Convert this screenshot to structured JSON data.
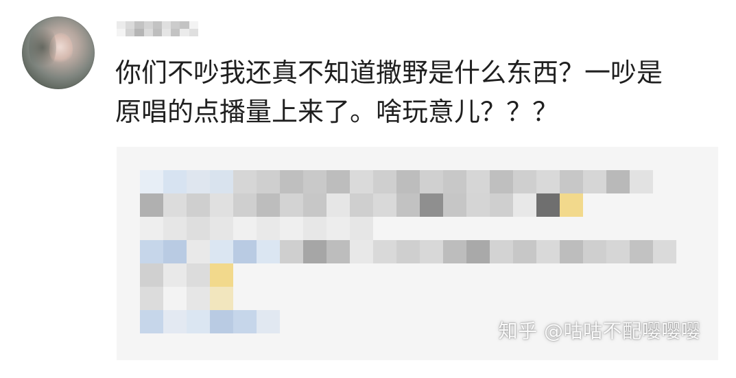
{
  "comment": {
    "text_line1": "你们不吵我还真不知道撒野是什么东西？一吵是",
    "text_line2": "原唱的点播量上来了。啥玩意儿？？？"
  },
  "watermark": {
    "text": "知乎 @咕咕不配嘤嘤嘤"
  },
  "colors": {
    "text": "#1f1f1f",
    "card_bg": "#f5f5f5",
    "blur_gray_light": "#e6e6e6",
    "blur_gray": "#bdbdbd",
    "blur_gray_dark": "#7d7d7d",
    "blur_blue_light": "#dbe6f2",
    "blur_blue": "#b9cbe3",
    "blur_yellow": "#f2d98c"
  }
}
